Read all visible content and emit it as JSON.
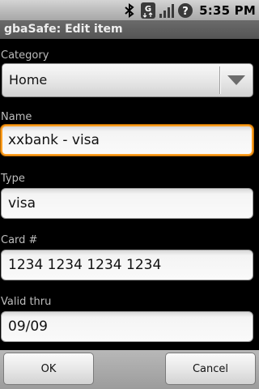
{
  "status_bar": {
    "time": "5:35 PM",
    "icons": [
      "bluetooth-icon",
      "gprs-data-icon",
      "signal-icon",
      "alert-icon"
    ]
  },
  "title": "gbaSafe: Edit item",
  "form": {
    "category_label": "Category",
    "category_value": "Home",
    "name_label": "Name",
    "name_value": "xxbank - visa",
    "type_label": "Type",
    "type_value": "visa",
    "card_label": "Card #",
    "card_value": "1234 1234 1234 1234",
    "valid_label": "Valid thru",
    "valid_value": "09/09"
  },
  "buttons": {
    "ok": "OK",
    "cancel": "Cancel"
  },
  "colors": {
    "focus": "#ff9e1f",
    "background": "#000000"
  }
}
